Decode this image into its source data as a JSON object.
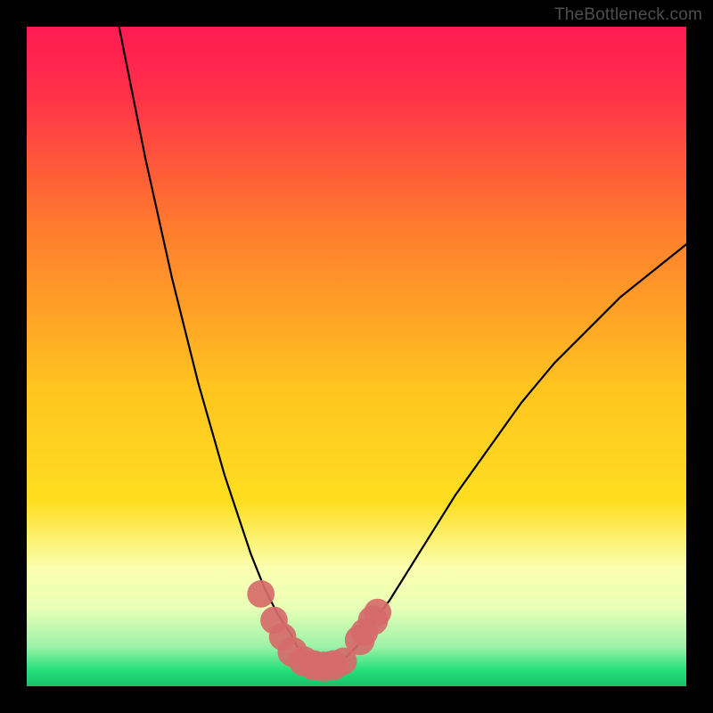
{
  "watermark": "TheBottleneck.com",
  "colors": {
    "frame": "#000000",
    "gradient_top": "#ff1a52",
    "gradient_mid1": "#ff7a2e",
    "gradient_mid2": "#fede20",
    "gradient_band": "#fbffaf",
    "gradient_green": "#27e07a",
    "curve": "#000000",
    "marker": "#d66a6a"
  },
  "chart_data": {
    "type": "line",
    "title": "",
    "xlabel": "",
    "ylabel": "",
    "xlim": [
      0,
      100
    ],
    "ylim": [
      0,
      100
    ],
    "series": [
      {
        "name": "bottleneck-curve",
        "x": [
          14,
          16,
          18,
          20,
          22,
          24,
          26,
          28,
          30,
          32,
          34,
          36,
          38,
          40,
          41,
          42,
          43,
          44,
          45,
          46,
          48,
          50,
          52,
          55,
          60,
          65,
          70,
          75,
          80,
          85,
          90,
          95,
          100
        ],
        "y": [
          100,
          90,
          80,
          71,
          62,
          54,
          46,
          39,
          32,
          26,
          20,
          15,
          11,
          8,
          6,
          5,
          4,
          3,
          3,
          3,
          4,
          6,
          9,
          13,
          21,
          29,
          36,
          43,
          49,
          54,
          59,
          63,
          67
        ]
      }
    ],
    "min_x": 44,
    "markers": [
      {
        "x": 35.5,
        "y": 14,
        "r": 1.4
      },
      {
        "x": 37.5,
        "y": 10,
        "r": 1.4
      },
      {
        "x": 38.8,
        "y": 7.5,
        "r": 1.4
      },
      {
        "x": 40.3,
        "y": 5.2,
        "r": 1.6
      },
      {
        "x": 42.0,
        "y": 3.8,
        "r": 1.6
      },
      {
        "x": 43.5,
        "y": 3.2,
        "r": 1.6
      },
      {
        "x": 45.0,
        "y": 3.0,
        "r": 1.6
      },
      {
        "x": 46.5,
        "y": 3.2,
        "r": 1.6
      },
      {
        "x": 48.0,
        "y": 3.8,
        "r": 1.4
      },
      {
        "x": 50.5,
        "y": 7.0,
        "r": 1.6
      },
      {
        "x": 51.2,
        "y": 8.2,
        "r": 1.4
      },
      {
        "x": 52.5,
        "y": 10.0,
        "r": 1.6
      },
      {
        "x": 53.2,
        "y": 11.2,
        "r": 1.4
      }
    ],
    "gradient_stops": [
      {
        "pos": 0.0,
        "color": "#ff1a52"
      },
      {
        "pos": 0.1,
        "color": "#ff3049"
      },
      {
        "pos": 0.3,
        "color": "#ff7a2e"
      },
      {
        "pos": 0.55,
        "color": "#ffc51f"
      },
      {
        "pos": 0.72,
        "color": "#fede20"
      },
      {
        "pos": 0.82,
        "color": "#fbffaf"
      },
      {
        "pos": 0.88,
        "color": "#e9ffb6"
      },
      {
        "pos": 0.94,
        "color": "#9cf2a8"
      },
      {
        "pos": 0.975,
        "color": "#27e07a"
      },
      {
        "pos": 1.0,
        "color": "#17c06a"
      }
    ]
  }
}
